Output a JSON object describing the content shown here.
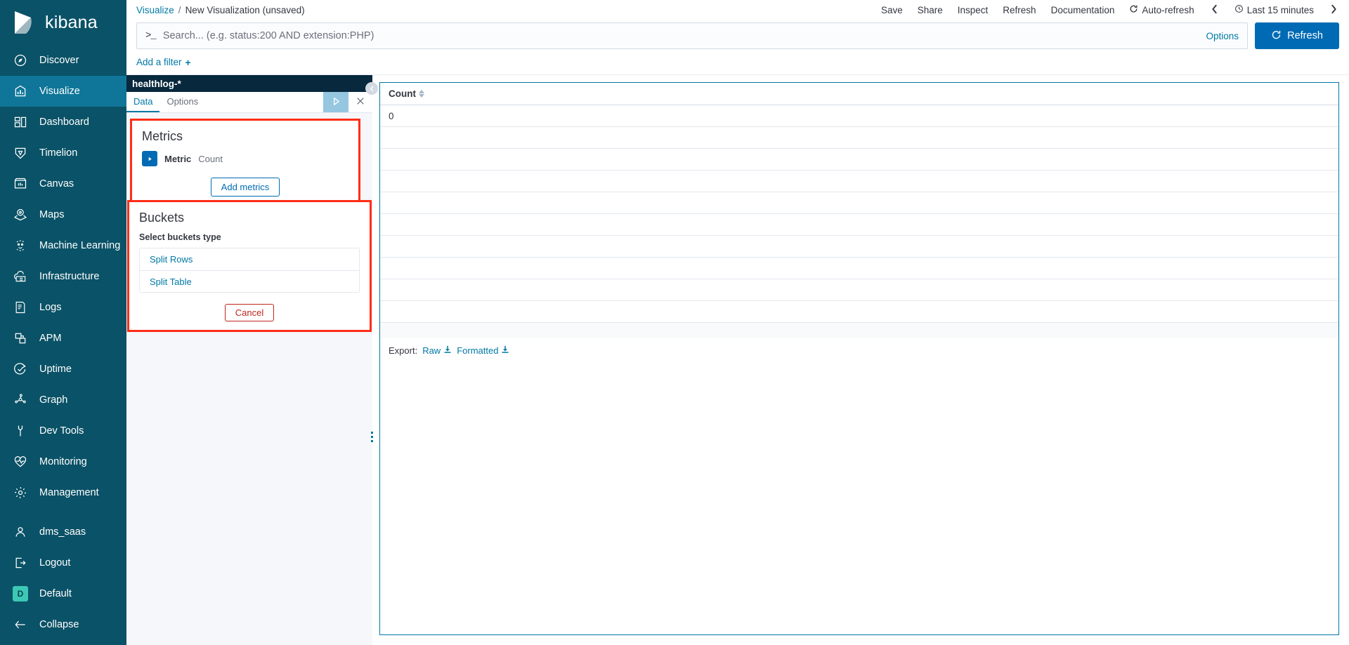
{
  "brand": {
    "name": "kibana",
    "logo_icon": "kibana-logo"
  },
  "sidebar": {
    "items": [
      {
        "label": "Discover",
        "icon": "compass-icon",
        "active": false
      },
      {
        "label": "Visualize",
        "icon": "bar-chart-icon",
        "active": true
      },
      {
        "label": "Dashboard",
        "icon": "dashboard-grid-icon",
        "active": false
      },
      {
        "label": "Timelion",
        "icon": "timelion-shield-icon",
        "active": false
      },
      {
        "label": "Canvas",
        "icon": "canvas-icon",
        "active": false
      },
      {
        "label": "Maps",
        "icon": "map-marker-layers-icon",
        "active": false
      },
      {
        "label": "Machine Learning",
        "icon": "machine-learning-icon",
        "active": false
      },
      {
        "label": "Infrastructure",
        "icon": "infrastructure-cloud-icon",
        "active": false
      },
      {
        "label": "Logs",
        "icon": "logs-document-icon",
        "active": false
      },
      {
        "label": "APM",
        "icon": "apm-icon",
        "active": false
      },
      {
        "label": "Uptime",
        "icon": "uptime-check-icon",
        "active": false
      },
      {
        "label": "Graph",
        "icon": "graph-nodes-icon",
        "active": false
      },
      {
        "label": "Dev Tools",
        "icon": "wrench-icon",
        "active": false
      },
      {
        "label": "Monitoring",
        "icon": "heartbeat-icon",
        "active": false
      },
      {
        "label": "Management",
        "icon": "gear-icon",
        "active": false
      }
    ],
    "footer": [
      {
        "label": "dms_saas",
        "icon": "user-icon"
      },
      {
        "label": "Logout",
        "icon": "logout-icon"
      },
      {
        "label": "Default",
        "icon": "space-badge",
        "badge": "D"
      },
      {
        "label": "Collapse",
        "icon": "arrow-left-icon"
      }
    ]
  },
  "breadcrumb": {
    "root": "Visualize",
    "separator": "/",
    "current": "New Visualization (unsaved)"
  },
  "top_actions": {
    "save": "Save",
    "share": "Share",
    "inspect": "Inspect",
    "refresh": "Refresh",
    "documentation": "Documentation",
    "auto_refresh": "Auto-refresh",
    "time_range": "Last 15 minutes",
    "prev_icon": "chevron-left-icon",
    "next_icon": "chevron-right-icon",
    "clock_icon": "clock-icon",
    "refresh_icon": "refresh-cycle-icon"
  },
  "query_bar": {
    "prompt": ">_",
    "placeholder": "Search... (e.g. status:200 AND extension:PHP)",
    "value": "",
    "options_label": "Options",
    "refresh_label": "Refresh"
  },
  "filter_bar": {
    "add_filter": "Add a filter",
    "plus": "+"
  },
  "editor": {
    "index_pattern": "healthlog-*",
    "tabs": [
      {
        "label": "Data",
        "active": true
      },
      {
        "label": "Options",
        "active": false
      }
    ],
    "apply_icon": "play-triangle-icon",
    "close_icon": "close-x-icon",
    "metrics": {
      "title": "Metrics",
      "metric_label": "Metric",
      "metric_value": "Count",
      "toggle_icon": "triangle-right-icon",
      "add_button": "Add metrics"
    },
    "buckets": {
      "title": "Buckets",
      "select_label": "Select buckets type",
      "options": [
        "Split Rows",
        "Split Table"
      ],
      "cancel_button": "Cancel"
    },
    "collapse_icon": "chevron-left-circle-icon",
    "drag_handle_icon": "drag-dots-icon"
  },
  "viz": {
    "table": {
      "columns": [
        "Count"
      ],
      "sort_icon": "sort-updown-icon",
      "rows": [
        [
          "0"
        ],
        [
          ""
        ],
        [
          ""
        ],
        [
          ""
        ],
        [
          ""
        ],
        [
          ""
        ],
        [
          ""
        ],
        [
          ""
        ],
        [
          ""
        ],
        [
          ""
        ]
      ]
    },
    "export": {
      "label": "Export:",
      "raw": "Raw",
      "formatted": "Formatted",
      "download_icon": "download-icon"
    }
  },
  "colors": {
    "sidebar_bg": "#0a5267",
    "sidebar_active": "#0f7699",
    "primary": "#006bb4",
    "link": "#0079a5",
    "index_header_bg": "#07283d",
    "annotation_red": "#ff2d16",
    "space_badge": "#3cc8b4",
    "danger": "#bd271e"
  }
}
